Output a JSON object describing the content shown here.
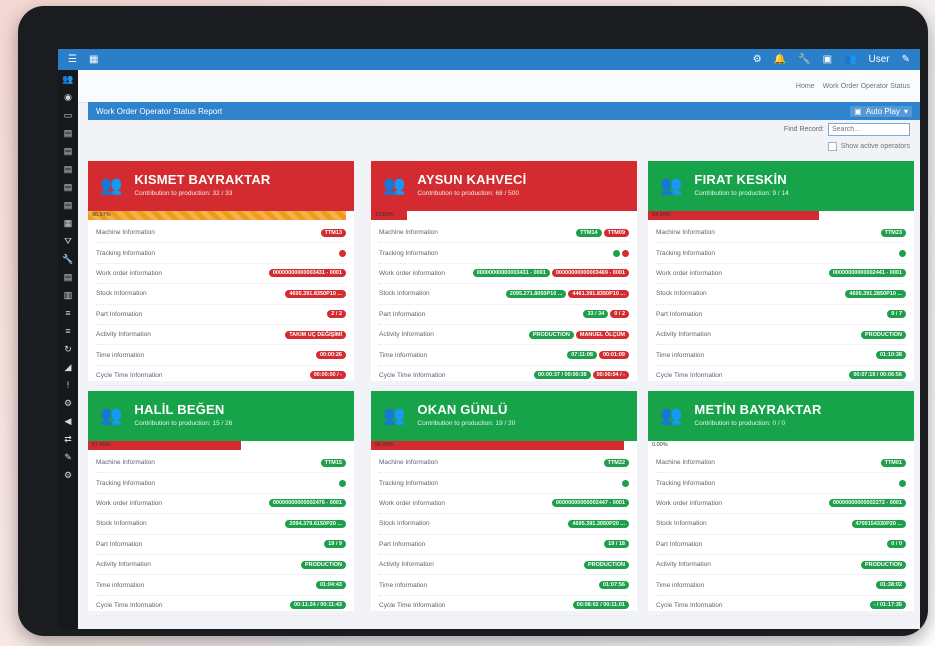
{
  "topbar": {
    "user_label": "User"
  },
  "breadcrumb": {
    "home": "Home",
    "current": "Work Order Operator Status"
  },
  "panel": {
    "title": "Work Order Operator Status Report",
    "autoplay_label": "Auto Play"
  },
  "search": {
    "label": "Find Record:",
    "placeholder": "Search..."
  },
  "show_active_label": "Show active operators",
  "row_labels": [
    "Machine Information",
    "Tracking Information",
    "Work order information",
    "Stock Information",
    "Part Information",
    "Activity Information",
    "Time information",
    "Cycle Time Information"
  ],
  "colors": {
    "red": "#d32b2f",
    "green": "#16a34a",
    "orange": "#f19a1b",
    "blue": "#2a7fc8"
  },
  "cards": [
    {
      "name": "KISMET BAYRAKTAR",
      "contribution": "Contribution to production: 32 / 33",
      "status": "red",
      "progress_label": "96.97%",
      "machine": [
        "TTM13"
      ],
      "tracking": "red",
      "workorder": [
        "00000000000003431 - 0001"
      ],
      "stock": [
        "4695.391.8350P10 ..."
      ],
      "part": [
        "2 / 2"
      ],
      "activity": [
        "TAKIM UÇ DEĞİŞİMİ"
      ],
      "time": [
        "00:00:26"
      ],
      "cycle": [
        "00:00:00 / -"
      ]
    },
    {
      "name": "AYSUN KAHVECİ",
      "contribution": "Contribution to production: 68 / 500",
      "status": "red",
      "progress_label": "13.60%",
      "machine": [
        "TTM14",
        "TTM09"
      ],
      "tracking": "redgreen",
      "workorder": [
        "00000000000003431 - 0001",
        "00000000000003469 - 0001"
      ],
      "stock": [
        "2095.271.8050P10 ...",
        "4461.391.8350P10 ..."
      ],
      "part": [
        "33 / 34",
        "0 / 2"
      ],
      "activity": [
        "PRODUCTION",
        "MANUEL ÖLÇÜM"
      ],
      "time": [
        "07:11:08",
        "00:01:09"
      ],
      "cycle": [
        "00:00:37 / 00:00:38",
        "00:00:04 / -"
      ]
    },
    {
      "name": "FIRAT KESKİN",
      "contribution": "Contribution to production: 9 / 14",
      "status": "green",
      "progress_label": "64.29%",
      "machine": [
        "TTM23"
      ],
      "tracking": "green",
      "workorder": [
        "00000000000002441 - 0001"
      ],
      "stock": [
        "4695.391.2850P10 ..."
      ],
      "part": [
        "9 / 7"
      ],
      "activity": [
        "PRODUCTION"
      ],
      "time": [
        "01:10:38"
      ],
      "cycle": [
        "00:07:19 / 00:06:56"
      ]
    },
    {
      "name": "HALİL BEĞEN",
      "contribution": "Contribution to production: 15 / 26",
      "status": "green",
      "progress_label": "57.69%",
      "machine": [
        "TTM15"
      ],
      "tracking": "green",
      "workorder": [
        "00000000000002476 - 0001"
      ],
      "stock": [
        "2094.379.6150P20 ..."
      ],
      "part": [
        "19 / 9"
      ],
      "activity": [
        "PRODUCTION"
      ],
      "time": [
        "01:04:43"
      ],
      "cycle": [
        "00:11:24 / 00:11:43"
      ]
    },
    {
      "name": "OKAN GÜNLÜ",
      "contribution": "Contribution to production: 19 / 20",
      "status": "green",
      "progress_label": "95.00%",
      "machine": [
        "TTM22"
      ],
      "tracking": "green",
      "workorder": [
        "00000000000002447 - 0001"
      ],
      "stock": [
        "4695.391.3050P20 ..."
      ],
      "part": [
        "19 / 18"
      ],
      "activity": [
        "PRODUCTION"
      ],
      "time": [
        "01:07:56"
      ],
      "cycle": [
        "00:08:02 / 00:11:01"
      ]
    },
    {
      "name": "METİN BAYRAKTAR",
      "contribution": "Contribution to production: 0 / 0",
      "status": "green",
      "progress_label": "0.00%",
      "machine": [
        "TTM01"
      ],
      "tracking": "green",
      "workorder": [
        "00000000000002272 - 0001"
      ],
      "stock": [
        "4700154330P20 ..."
      ],
      "part": [
        "0 / 0"
      ],
      "activity": [
        "PRODUCTION"
      ],
      "time": [
        "01:38:02"
      ],
      "cycle": [
        "- / 01:17:35"
      ]
    }
  ],
  "progress_fractions": [
    0.9697,
    0.136,
    0.6429,
    0.5769,
    0.95,
    0.0
  ]
}
